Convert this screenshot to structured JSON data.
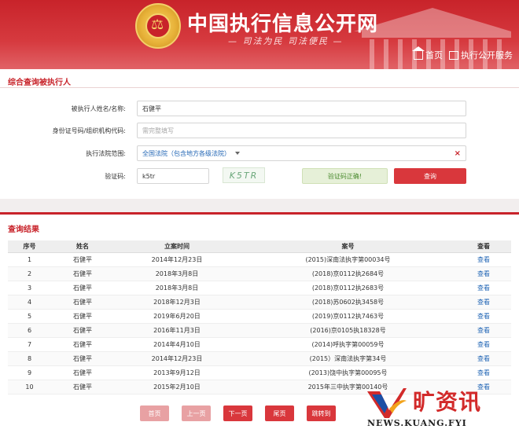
{
  "header": {
    "site_title": "中国执行信息公开网",
    "motto": "— 司法为民  司法便民 —",
    "nav": [
      {
        "label": "首页",
        "icon": "home-icon"
      },
      {
        "label": "执行公开服务",
        "icon": "grid-icon"
      }
    ]
  },
  "search": {
    "section_title": "综合查询被执行人",
    "name_label": "被执行人姓名/名称:",
    "name_value": "石健平",
    "id_label": "身份证号码/组织机构代码:",
    "id_placeholder": "需完整填写",
    "court_label": "执行法院范围:",
    "court_value": "全国法院（包含地方各级法院）",
    "captcha_label": "验证码:",
    "captcha_value": "k5tr",
    "captcha_image_text": "K5TR",
    "verify_status": "验证码正确!",
    "query_button": "查询"
  },
  "results": {
    "section_title": "查询结果",
    "columns": [
      "序号",
      "姓名",
      "立案时间",
      "案号",
      "查看"
    ],
    "rows": [
      [
        "1",
        "石健平",
        "2014年12月23日",
        "(2015)深南法执字第00034号",
        "查看"
      ],
      [
        "2",
        "石健平",
        "2018年3月8日",
        "(2018)京0112执2684号",
        "查看"
      ],
      [
        "3",
        "石健平",
        "2018年3月8日",
        "(2018)京0112执2683号",
        "查看"
      ],
      [
        "4",
        "石健平",
        "2018年12月3日",
        "(2018)苏0602执3458号",
        "查看"
      ],
      [
        "5",
        "石健平",
        "2019年6月20日",
        "(2019)京0112执7463号",
        "查看"
      ],
      [
        "6",
        "石健平",
        "2016年11月3日",
        "(2016)京0105执18328号",
        "查看"
      ],
      [
        "7",
        "石健平",
        "2014年4月10日",
        "(2014)呼执字第00059号",
        "查看"
      ],
      [
        "8",
        "石健平",
        "2014年12月23日",
        "(2015）深南法执字第34号",
        "查看"
      ],
      [
        "9",
        "石健平",
        "2013年9月12日",
        "(2013)饶中执字第00095号",
        "查看"
      ],
      [
        "10",
        "石健平",
        "2015年2月10日",
        "2015年三中执字第00140号",
        "查看"
      ]
    ]
  },
  "pager": {
    "first": "首页",
    "prev": "上一页",
    "next": "下一页",
    "last": "尾页",
    "jump": "跳转到"
  },
  "watermark": {
    "brand": "旷资讯",
    "url": "NEWS.KUANG.FYI"
  },
  "colors": {
    "brand_red": "#c8232a",
    "button_red": "#d9373c",
    "disabled_red": "#e8a1a3",
    "link_blue": "#2266b5",
    "success_green": "#4b8b30"
  }
}
